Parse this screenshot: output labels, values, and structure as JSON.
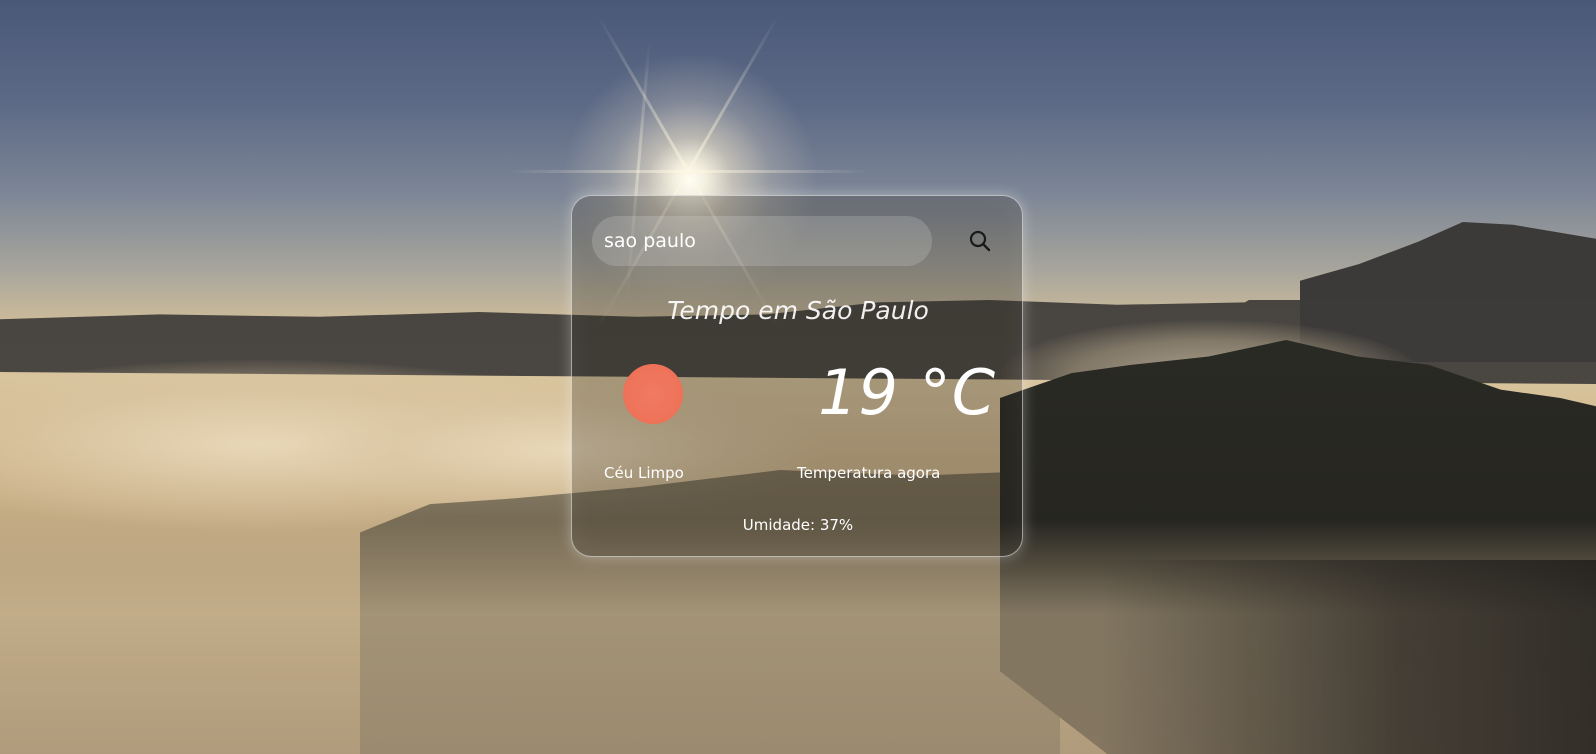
{
  "search": {
    "value": "sao paulo",
    "button_icon": "search-icon"
  },
  "weather": {
    "title": "Tempo em São Paulo",
    "condition_icon": "sun-icon",
    "condition_icon_color": "#ee7258",
    "condition": "Céu Limpo",
    "temperature": "19 °C",
    "temperature_label": "Temperatura agora",
    "humidity": "Umidade: 37%"
  }
}
